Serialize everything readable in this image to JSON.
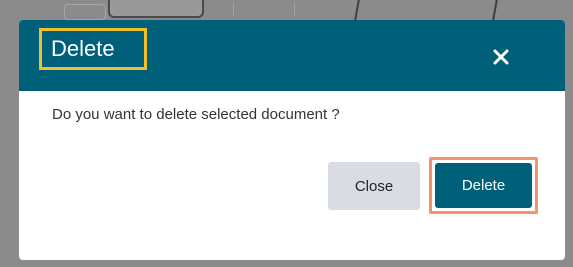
{
  "dialog": {
    "title": "Delete",
    "message": "Do you want to delete selected document ?",
    "close_icon": "close-icon",
    "buttons": {
      "close_label": "Close",
      "delete_label": "Delete"
    }
  },
  "colors": {
    "header_background": "#00607a",
    "title_highlight": "#f0c02a",
    "delete_highlight": "#f0946c",
    "close_button_background": "#d9dde3",
    "delete_button_background": "#00607a"
  }
}
